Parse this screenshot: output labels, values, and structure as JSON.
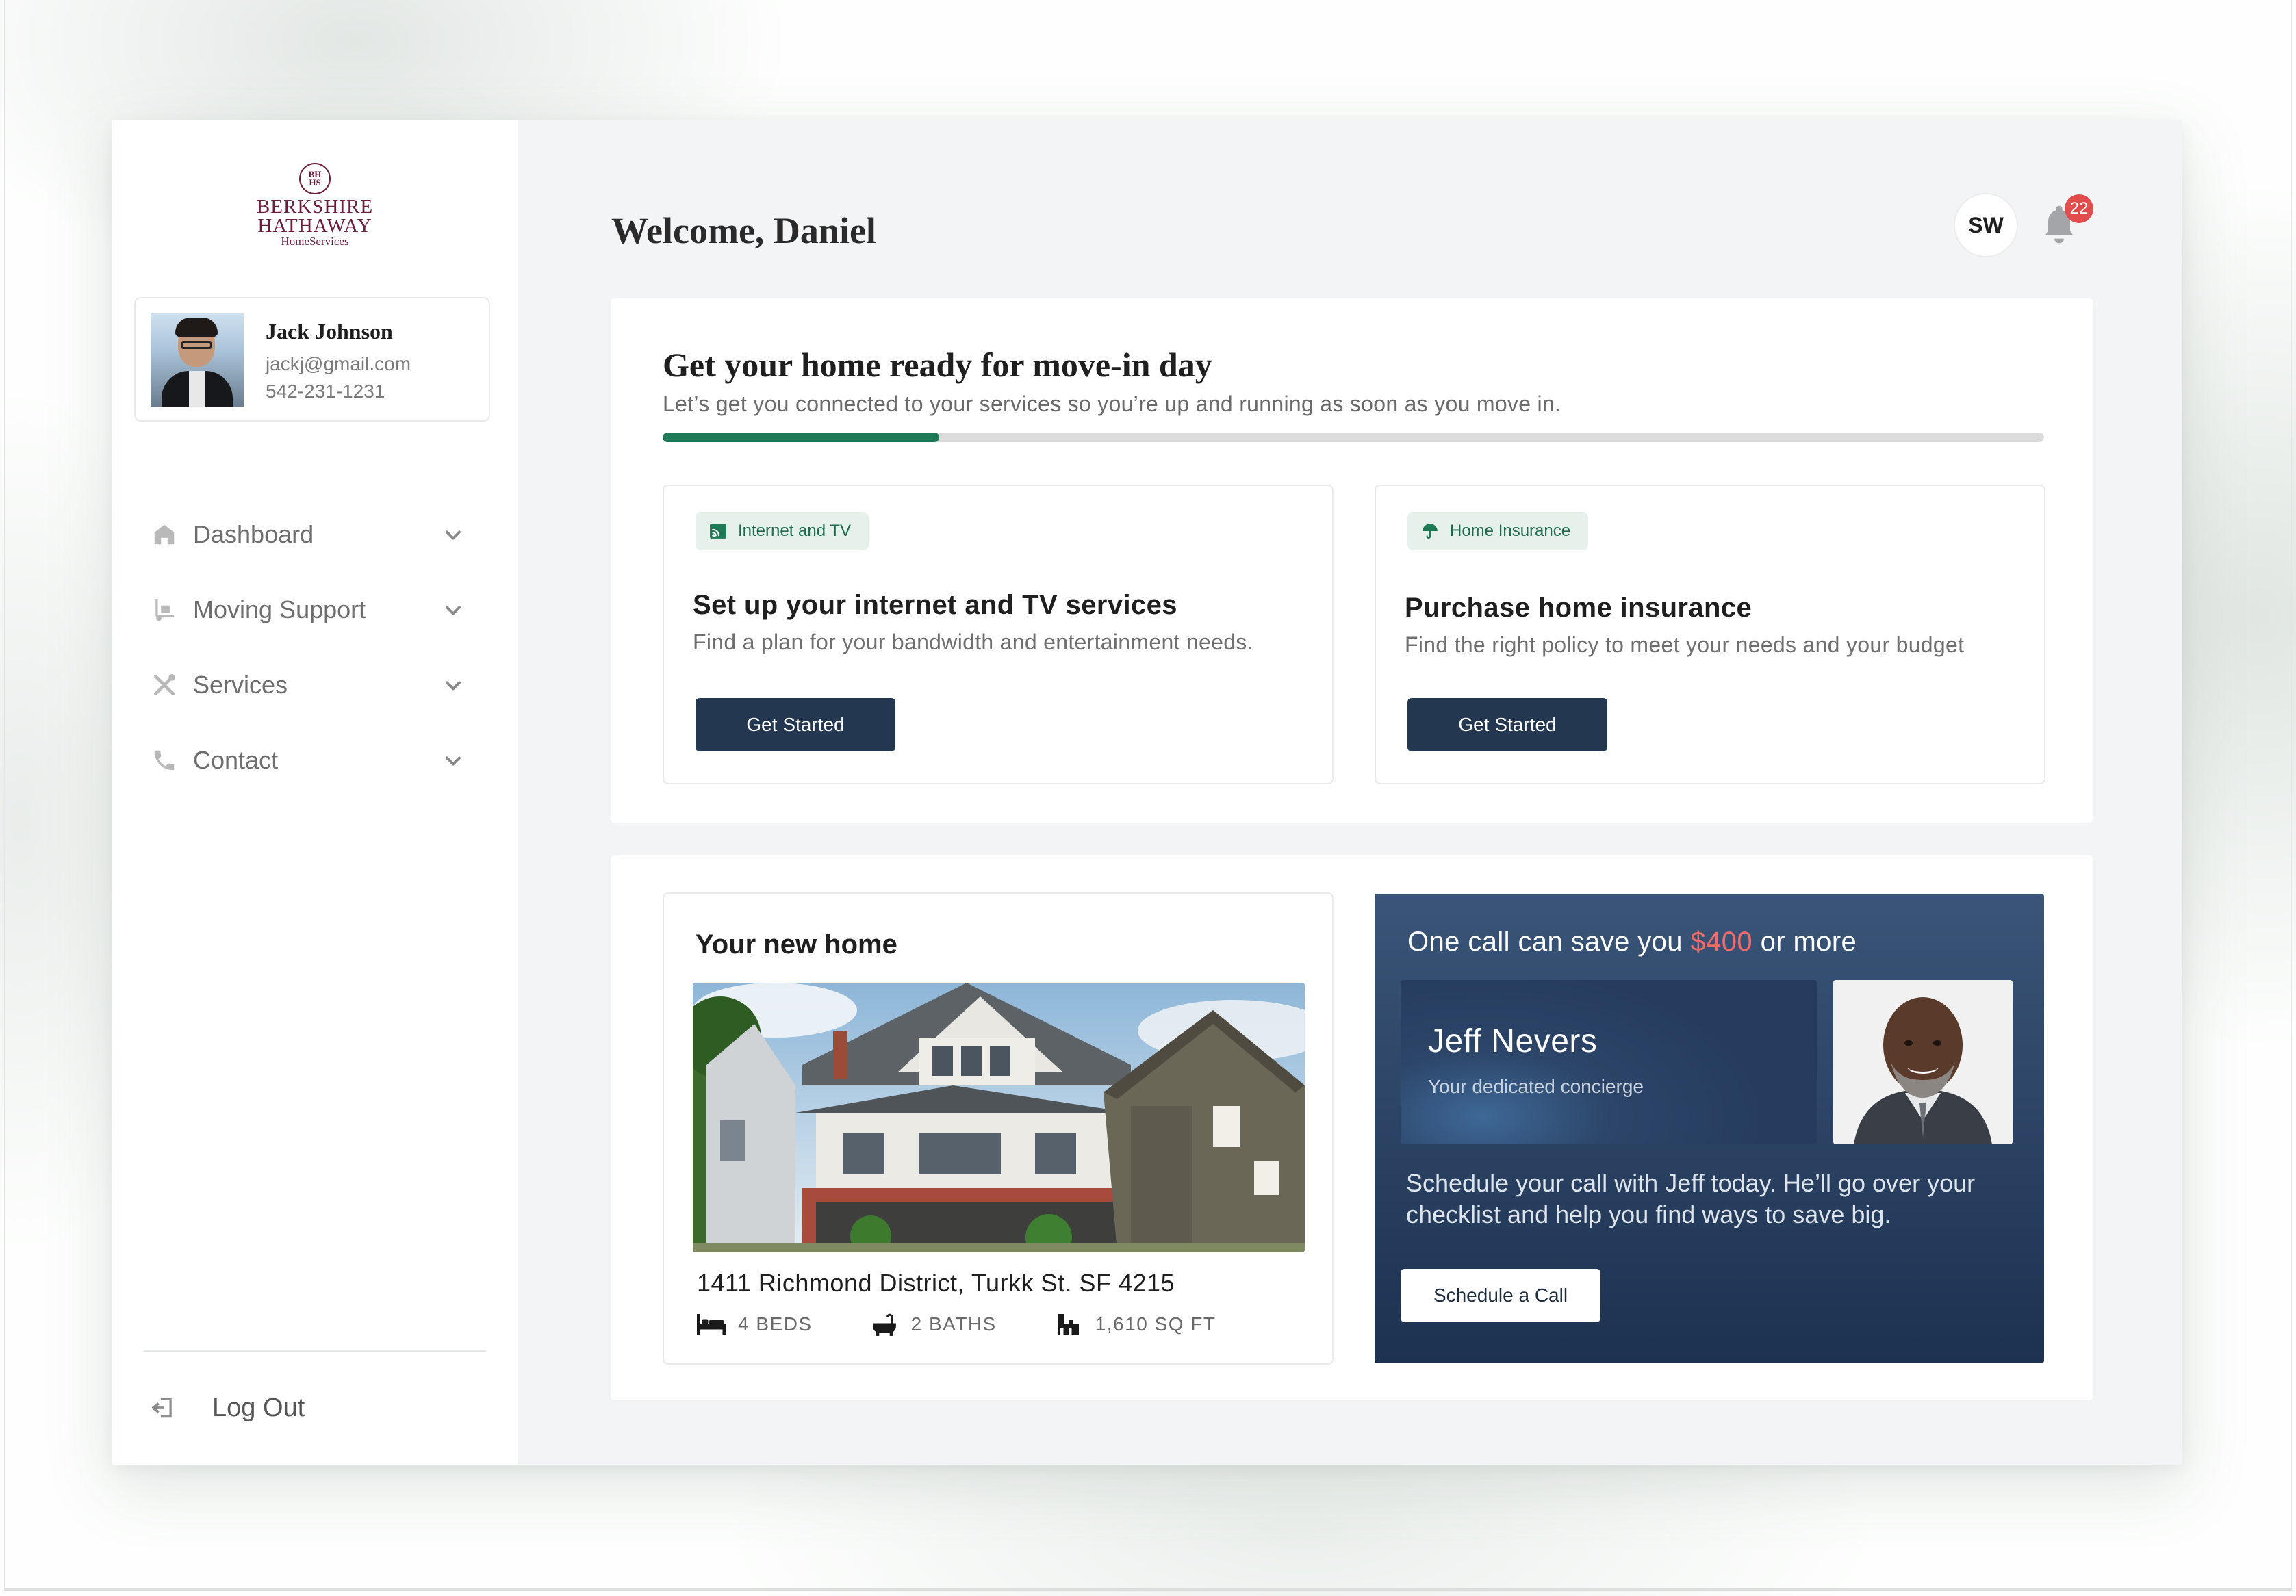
{
  "logo": {
    "seal": "BH\nHS",
    "line1": "BERKSHIRE",
    "line2": "HATHAWAY",
    "line3": "HomeServices"
  },
  "profile": {
    "name": "Jack Johnson",
    "email": "jackj@gmail.com",
    "phone": "542-231-1231"
  },
  "nav": [
    {
      "label": "Dashboard",
      "icon": "home-icon"
    },
    {
      "label": "Moving Support",
      "icon": "hand-truck-icon"
    },
    {
      "label": "Services",
      "icon": "tools-icon"
    },
    {
      "label": "Contact",
      "icon": "phone-icon"
    }
  ],
  "logout_label": "Log Out",
  "header": {
    "welcome": "Welcome, Daniel",
    "user_initials": "SW",
    "notification_count": "22"
  },
  "move_in": {
    "title": "Get your home ready for move-in day",
    "subtitle": "Let’s get you connected to your services so you’re up and running as soon as you move in.",
    "progress": 0.2
  },
  "services": [
    {
      "tag": "Internet and TV",
      "tag_icon": "cast-icon",
      "title": "Set up your internet and TV services",
      "description": "Find a plan for your bandwidth and entertainment needs.",
      "button": "Get Started"
    },
    {
      "tag": "Home Insurance",
      "tag_icon": "umbrella-icon",
      "title": "Purchase home insurance",
      "description": "Find the right policy to meet your needs and your budget",
      "button": "Get Started"
    }
  ],
  "home": {
    "title": "Your new home",
    "address": "1411 Richmond District, Turkk St. SF 4215",
    "beds": "4 BEDS",
    "baths": "2 BATHS",
    "sqft": "1,610 SQ FT"
  },
  "promo": {
    "title_prefix": "One call can save you ",
    "amount": "$400",
    "title_suffix": " or more",
    "concierge_name": "Jeff Nevers",
    "concierge_role": "Your dedicated concierge",
    "text": "Schedule your call with Jeff today. He’ll go over your checklist and help you find ways to save big.",
    "button": "Schedule a Call"
  },
  "colors": {
    "accent_green": "#1f7a57",
    "navy": "#243750",
    "alert_red": "#e34c4c",
    "brand_maroon": "#6b1e3d"
  }
}
